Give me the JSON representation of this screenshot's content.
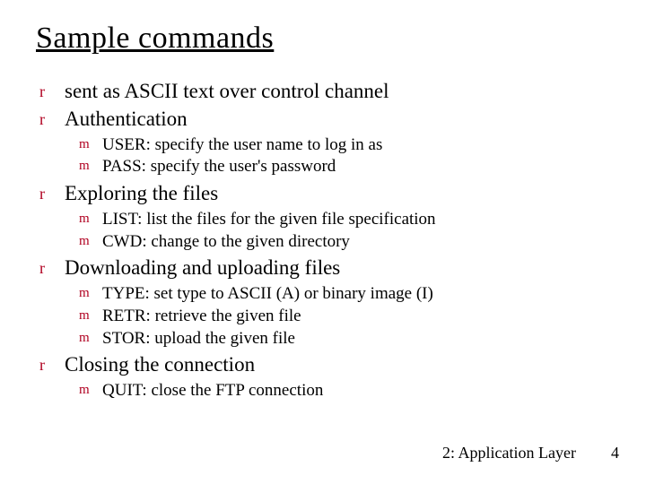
{
  "title": "Sample commands",
  "bullets": {
    "b0": "sent as ASCII text over control channel",
    "b1": "Authentication",
    "b1_sub": {
      "s0": "USER: specify the user name to log in as",
      "s1": "PASS: specify the user's password"
    },
    "b2": "Exploring the files",
    "b2_sub": {
      "s0": "LIST: list the files for the given file specification",
      "s1": "CWD: change to the given directory"
    },
    "b3": "Downloading and uploading files",
    "b3_sub": {
      "s0": "TYPE: set type to ASCII (A) or binary image (I)",
      "s1": "RETR: retrieve the given file",
      "s2": "STOR: upload the given file"
    },
    "b4": "Closing the connection",
    "b4_sub": {
      "s0": "QUIT: close the FTP connection"
    }
  },
  "markers": {
    "lvl1": "r",
    "lvl2": "m"
  },
  "footer": {
    "chapter": "2: Application Layer",
    "page": "4"
  }
}
